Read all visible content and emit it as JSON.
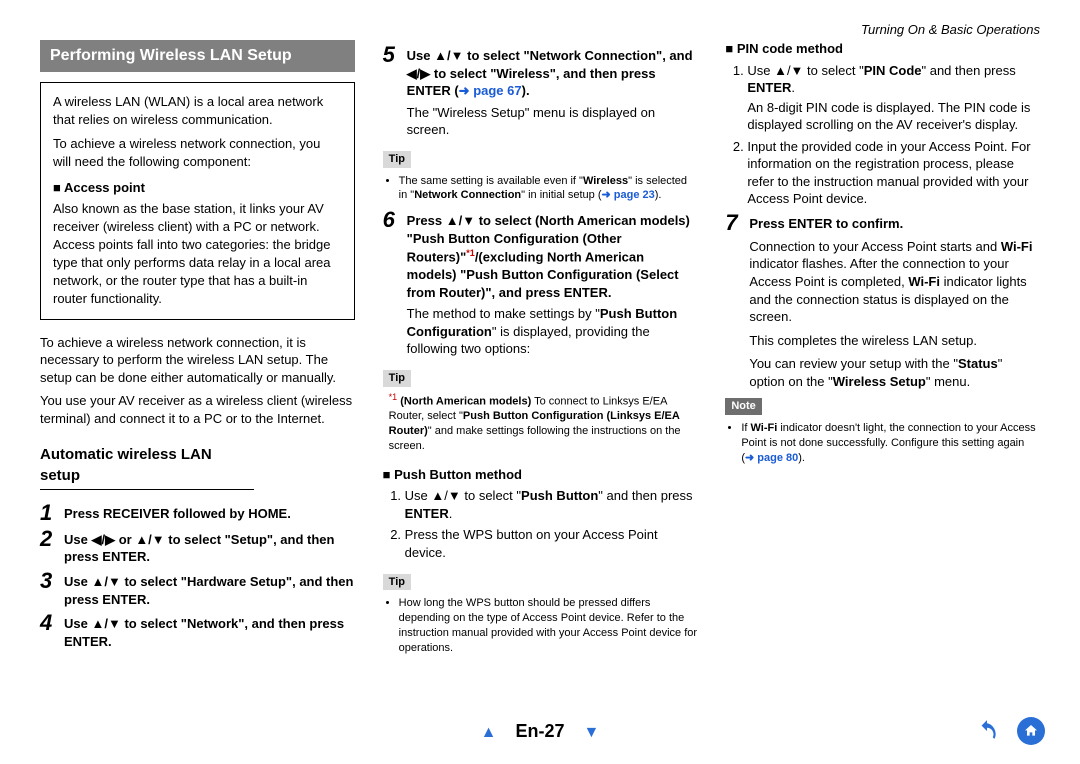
{
  "header": {
    "right": "Turning On & Basic Operations"
  },
  "section_title": "Performing Wireless LAN Setup",
  "box": {
    "p1": "A wireless LAN (WLAN) is a local area network that relies on wireless communication.",
    "p2": "To achieve a wireless network connection, you will need the following component:",
    "ap_h": "Access point",
    "ap_body": "Also known as the base station, it links your AV receiver (wireless client) with a PC or network. Access points fall into two categories: the bridge type that only performs data relay in a local area network, or the router type that has a built-in router functionality."
  },
  "intro": {
    "p1": "To achieve a wireless network connection, it is necessary to perform the wireless LAN setup. The setup can be done either automatically or manually.",
    "p2": "You use your AV receiver as a wireless client (wireless terminal) and connect it to a PC or to the Internet."
  },
  "auto_h": "Automatic wireless LAN setup",
  "steps": {
    "s1": "Press RECEIVER followed by HOME.",
    "s2_a": "Use ",
    "s2_b": " or ",
    "s2_c": " to select \"Setup\", and then press ENTER.",
    "s3_a": "Use ",
    "s3_b": " to select \"Hardware Setup\", and then press ENTER.",
    "s4_a": "Use ",
    "s4_b": " to select \"Network\", and then press ENTER.",
    "s5_a": "Use ",
    "s5_b": " to select \"Network Connection\", and ",
    "s5_c": " to select \"Wireless\", and then press ENTER (",
    "s5_link": "page 67",
    "s5_d": ").",
    "s5_body": "The \"Wireless Setup\" menu is displayed on screen.",
    "s5_tip_a": "The same setting is available even if \"",
    "s5_tip_b": "\" is selected in \"",
    "s5_tip_c": "\" in initial setup (",
    "s5_tip_link": "page 23",
    "s5_tip_d": ").",
    "s5_tip_w": "Wireless",
    "s5_tip_n": "Network Connection",
    "s6_a": "Press ",
    "s6_b": " to select (North American models) \"Push Button Configuration (Other Routers)\"",
    "s6_c": "/(excluding North American models) \"Push Button Configuration (Select from Router)\", and press ENTER.",
    "s6_body_a": "The method to make settings by \"",
    "s6_body_b": "Push Button Configuration",
    "s6_body_c": "\" is displayed, providing the following two options:",
    "s6_tip_a": "(North American models)",
    "s6_tip_b": " To connect to Linksys E/EA Router, select \"",
    "s6_tip_c": "Push Button Configuration (Linksys E/EA Router)",
    "s6_tip_d": "\" and make settings following the instructions on the screen.",
    "pb_h": "Push Button method",
    "pb_1a": "Use ",
    "pb_1b": " to select \"",
    "pb_1c": "Push Button",
    "pb_1d": "\" and then press ",
    "pb_1e": "ENTER",
    "pb_1f": ".",
    "pb_2": "Press the WPS button on your Access Point device.",
    "pb_tip": "How long the WPS button should be pressed differs depending on the type of Access Point device. Refer to the instruction manual provided with your Access Point device for operations.",
    "pin_h": "PIN code method",
    "pin_1a": "Use ",
    "pin_1b": " to select \"",
    "pin_1c": "PIN Code",
    "pin_1d": "\" and then press ",
    "pin_1e": "ENTER",
    "pin_1f": ".",
    "pin_1g": "An 8-digit PIN code is displayed. The PIN code is displayed scrolling on the AV receiver's display.",
    "pin_2": "Input the provided code in your Access Point. For information on the registration process, please refer to the instruction manual provided with your Access Point device.",
    "s7": "Press ENTER to confirm.",
    "s7_b1a": "Connection to your Access Point starts and ",
    "s7_b1b": "Wi-Fi",
    "s7_b1c": " indicator flashes. After the connection to your Access Point is completed, ",
    "s7_b1d": " indicator lights and the connection status is displayed on the screen.",
    "s7_b2": "This completes the wireless LAN setup.",
    "s7_b3a": "You can review your setup with the \"",
    "s7_b3b": "Status",
    "s7_b3c": "\" option on the \"",
    "s7_b3d": "Wireless Setup",
    "s7_b3e": "\" menu.",
    "note_a": "If ",
    "note_b": "Wi-Fi",
    "note_c": " indicator doesn't light, the connection to your Access Point is not done successfully. Configure this setting again (",
    "note_link": "page 80",
    "note_d": ")."
  },
  "labels": {
    "tip": "Tip",
    "note": "Note",
    "star": "*1"
  },
  "footer": {
    "page": "En-27"
  }
}
